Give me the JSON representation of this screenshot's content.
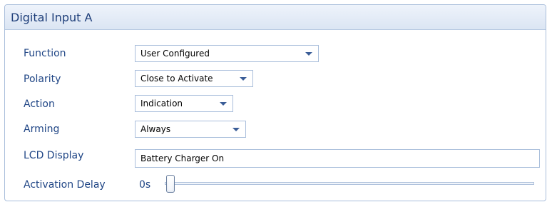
{
  "panel": {
    "title": "Digital Input A"
  },
  "fields": {
    "function": {
      "label": "Function",
      "value": "User Configured"
    },
    "polarity": {
      "label": "Polarity",
      "value": "Close to Activate"
    },
    "action": {
      "label": "Action",
      "value": "Indication"
    },
    "arming": {
      "label": "Arming",
      "value": "Always"
    },
    "lcd_display": {
      "label": "LCD Display",
      "value": "Battery Charger On"
    },
    "activation_delay": {
      "label": "Activation Delay",
      "value": "0s",
      "slider_fraction": 0.0
    }
  },
  "icons": {
    "dropdown": "chevron-down-icon"
  },
  "colors": {
    "label_text": "#1f4585",
    "header_title": "#1f3f7a",
    "header_bg_top": "#eef3fb",
    "header_bg_bottom": "#dbe5f3",
    "border": "#a9bedb",
    "dropdown_arrow": "#3a5d97"
  }
}
